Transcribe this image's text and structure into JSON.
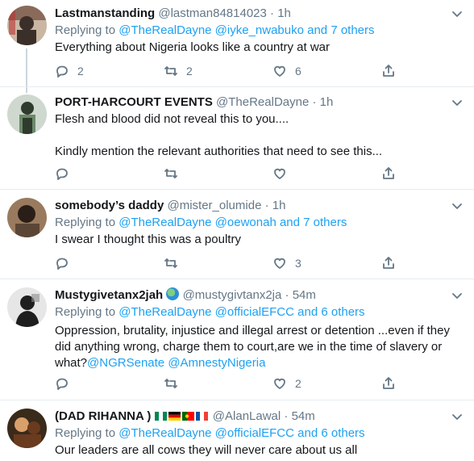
{
  "tweets": [
    {
      "name": "Lastmanstanding",
      "handle": "@lastman84814023",
      "dot": "·",
      "time": "1h",
      "replying_prefix": "Replying to",
      "replying_to": "@TheRealDayne @iyke_nwabuko and 7 others",
      "text_lines": [
        "Everything about Nigeria looks like a country at war"
      ],
      "reply_count": "2",
      "retweet_count": "2",
      "like_count": "6",
      "avatar_colors": [
        "#8a6a5a",
        "#c9b7a3",
        "#3b2f2a"
      ]
    },
    {
      "name": "PORT-HARCOURT EVENTS",
      "handle": "@TheRealDayne",
      "dot": "·",
      "time": "1h",
      "text_lines": [
        "Flesh and blood did not reveal this to you....",
        "",
        "Kindly mention the relevant authorities that need to see this..."
      ],
      "reply_count": "",
      "retweet_count": "",
      "like_count": "",
      "avatar_colors": [
        "#cfd8cf",
        "#2f3b2c",
        "#6b8a6a"
      ]
    },
    {
      "name": "somebody’s daddy",
      "handle": "@mister_olumide",
      "dot": "·",
      "time": "1h",
      "replying_prefix": "Replying to",
      "replying_to": "@TheRealDayne @oewonah and 7 others",
      "text_lines": [
        "I swear I thought this was a poultry"
      ],
      "reply_count": "",
      "retweet_count": "",
      "like_count": "3",
      "avatar_colors": [
        "#5b4636",
        "#2a1f18",
        "#9a7a5e"
      ]
    },
    {
      "name": "Mustygivetanx2jah",
      "handle": "@mustygivtanx2ja",
      "dot": "·",
      "time": "54m",
      "replying_prefix": "Replying to",
      "replying_to": "@TheRealDayne @officialEFCC and 6 others",
      "text_lines": [
        "Oppression, brutality, injustice and illegal arrest or detention ...even if they",
        "did  anything wrong, charge them to court,are we in the time of slavery or",
        "what?"
      ],
      "mentions": [
        "@NGRSenate",
        "@AmnestyNigeria"
      ],
      "reply_count": "",
      "retweet_count": "",
      "like_count": "2",
      "avatar_colors": [
        "#e6e6e6",
        "#1e1e1e",
        "#8c8c8c"
      ]
    },
    {
      "name": "(DAD RIHANNA )",
      "handle": "@AlanLawal",
      "dot": "·",
      "time": "54m",
      "replying_prefix": "Replying to",
      "replying_to": "@TheRealDayne @officialEFCC and 6 others",
      "text_lines": [
        "Our leaders are all cows they will never care about us all"
      ],
      "flags": [
        "nigeria-flag",
        "germany-flag",
        "portugal-flag",
        "france-flag"
      ],
      "avatar_colors": [
        "#6a3b1e",
        "#d9a06b",
        "#3a2a1a"
      ]
    }
  ]
}
